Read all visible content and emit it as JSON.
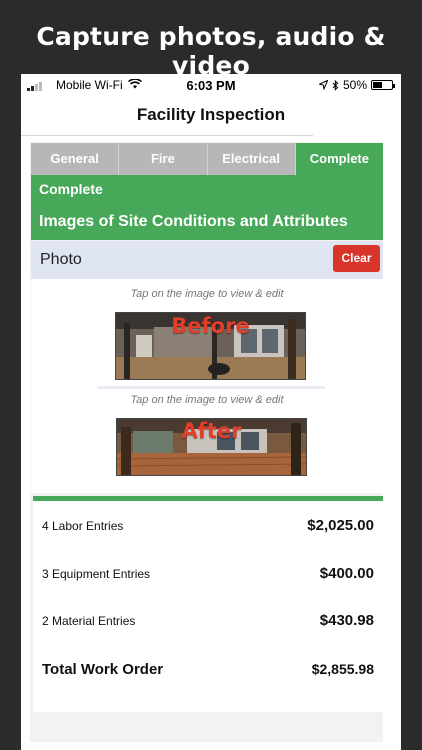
{
  "promo": {
    "headline": "Capture photos, audio & video"
  },
  "status_bar": {
    "carrier": "Mobile Wi-Fi",
    "time": "6:03 PM",
    "battery": "50%",
    "battery_level": 0.5
  },
  "nav": {
    "title": "Facility Inspection"
  },
  "tabs": [
    {
      "label": "General",
      "active": false
    },
    {
      "label": "Fire",
      "active": false
    },
    {
      "label": "Electrical",
      "active": false
    },
    {
      "label": "Complete",
      "active": true
    }
  ],
  "section": {
    "subtitle": "Complete",
    "title": "Images of Site Conditions and Attributes"
  },
  "photo": {
    "label": "Photo",
    "clear_label": "Clear",
    "images": [
      {
        "hint": "Tap on the image to view & edit",
        "overlay": "Before"
      },
      {
        "hint": "Tap on the image to view & edit",
        "overlay": "After"
      }
    ]
  },
  "summary": {
    "rows": [
      {
        "label": "4 Labor Entries",
        "value": "$2,025.00"
      },
      {
        "label": "3 Equipment Entries",
        "value": "$400.00"
      },
      {
        "label": "2 Material Entries",
        "value": "$430.98"
      }
    ],
    "total": {
      "label": "Total Work Order",
      "value": "$2,855.98"
    }
  },
  "colors": {
    "accent_green": "#48a85a",
    "clear_red": "#d8342a",
    "tab_inactive": "#b7b7b7",
    "photo_bar": "#e0e6f1",
    "overlay_red": "#e23e2a"
  }
}
